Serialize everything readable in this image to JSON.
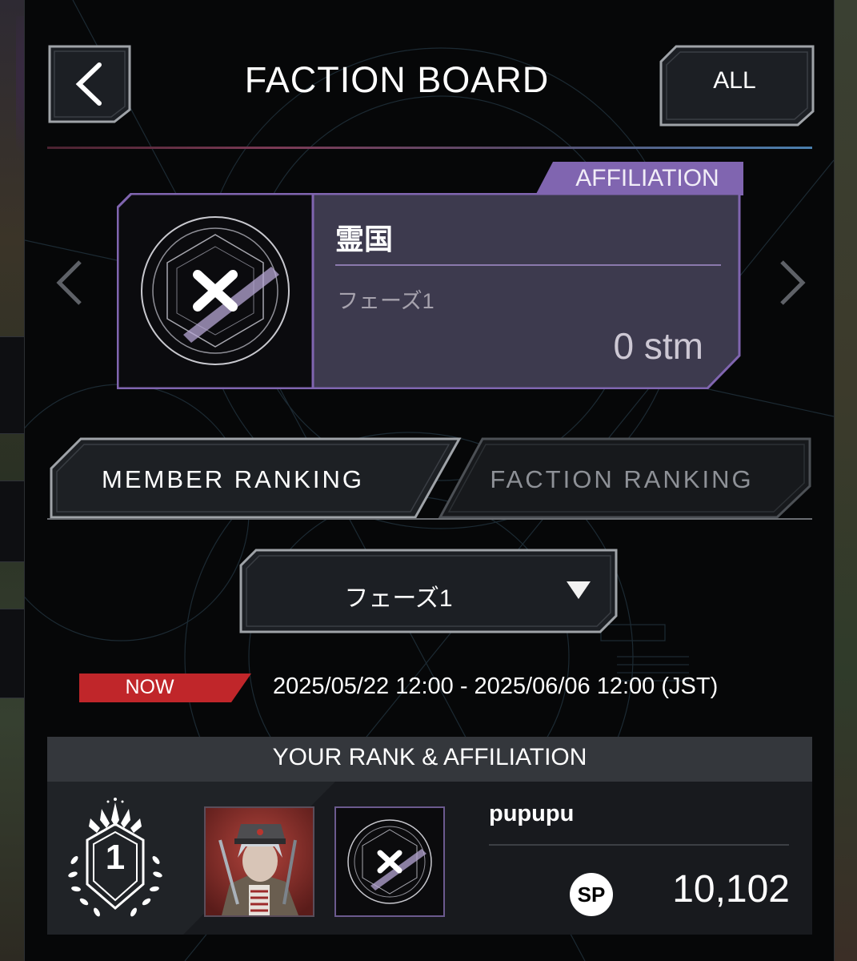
{
  "header": {
    "title": "FACTION BOARD",
    "all_label": "ALL"
  },
  "affiliation": {
    "tag_label": "AFFILIATION",
    "faction_name": "霊国",
    "phase": "フェーズ1",
    "points": "0 stm"
  },
  "tabs": [
    {
      "label": "MEMBER RANKING",
      "active": true
    },
    {
      "label": "FACTION RANKING",
      "active": false
    }
  ],
  "phase_select": {
    "selected": "フェーズ1"
  },
  "period": {
    "status": "NOW",
    "range": "2025/05/22 12:00 - 2025/06/06 12:00 (JST)"
  },
  "your_rank": {
    "section_title": "YOUR RANK & AFFILIATION",
    "rank": "1",
    "user_name": "pupupu",
    "sp_badge": "SP",
    "sp_value": "10,102"
  },
  "colors": {
    "panel": "#060708",
    "affiliation_accent": "#8065b0",
    "card_fill": "#3d3a4e",
    "now_badge": "#c0262a",
    "text": "#ffffff"
  },
  "icons": [
    "back-arrow-icon",
    "prev-arrow-icon",
    "next-arrow-icon",
    "dropdown-triangle-icon",
    "faction-emblem-icon",
    "rank-laurel-icon"
  ]
}
